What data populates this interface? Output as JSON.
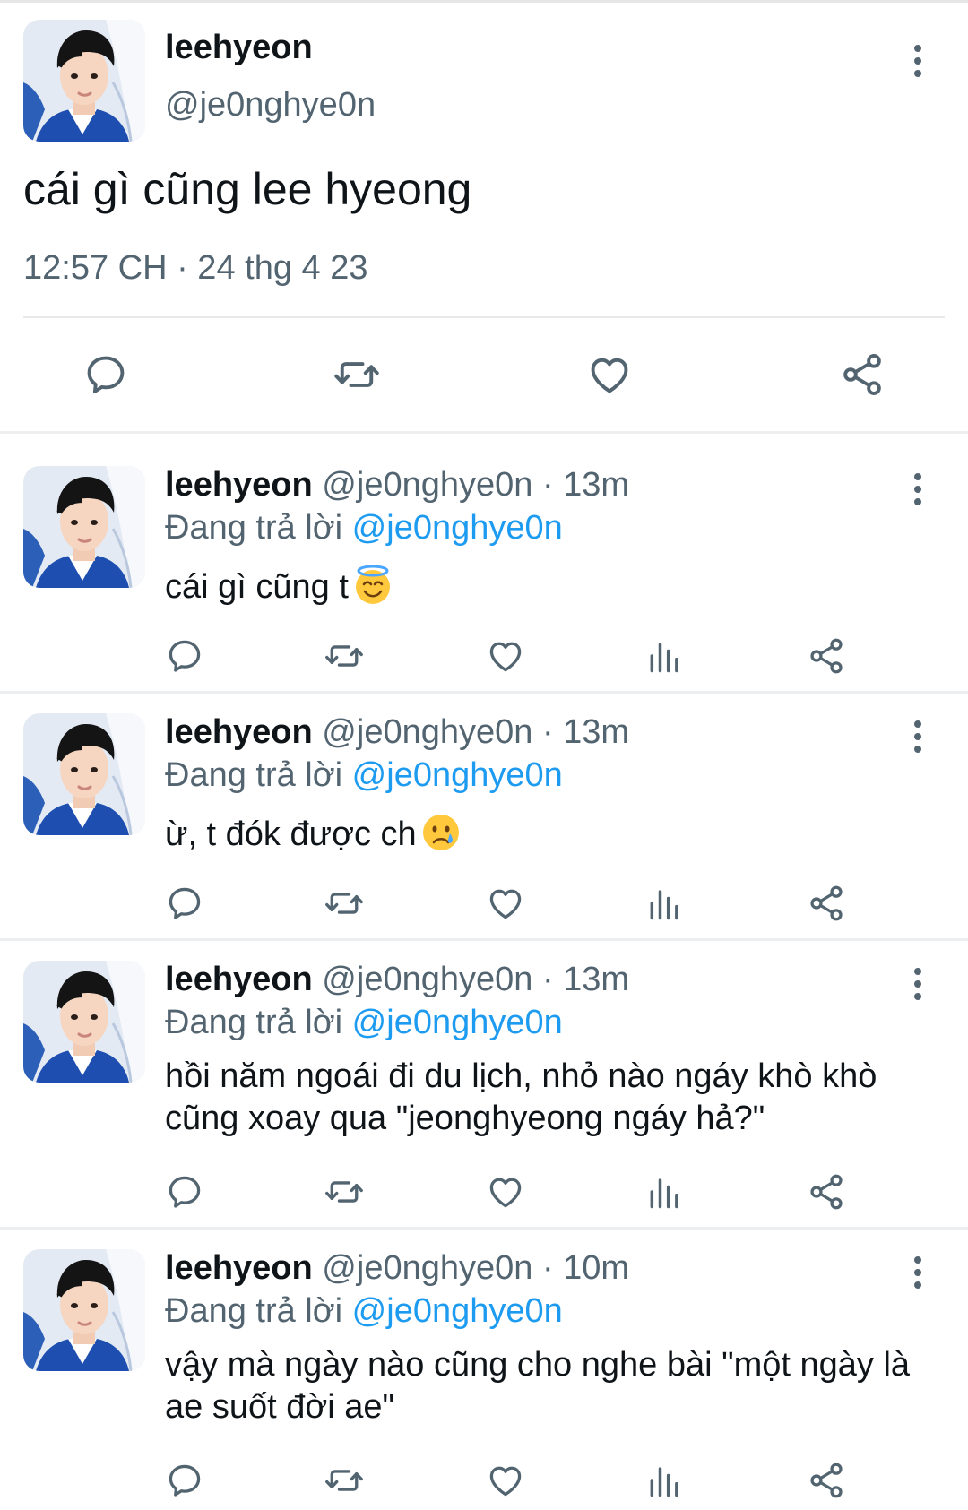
{
  "main_tweet": {
    "name": "leehyeon",
    "handle": "@je0nghye0n",
    "text": "cái gì cũng lee hyeong",
    "timestamp": "12:57 CH · 24 thg 4 23",
    "actions": [
      "reply-icon",
      "retweet-icon",
      "like-icon",
      "share-icon"
    ]
  },
  "replying_prefix": "Đang trả lời",
  "replies": [
    {
      "name": "leehyeon",
      "meta": "@je0nghye0n · 13m",
      "mention": "@je0nghye0n",
      "text": "cái gì cũng t",
      "emoji": "smiling-face-with-halo"
    },
    {
      "name": "leehyeon",
      "meta": "@je0nghye0n · 13m",
      "mention": "@je0nghye0n",
      "text": "ừ, t đók được ch",
      "emoji": "crying-face"
    },
    {
      "name": "leehyeon",
      "meta": "@je0nghye0n · 13m",
      "mention": "@je0nghye0n",
      "text": "hồi năm ngoái đi du lịch, nhỏ nào ngáy khò khò cũng xoay qua \"jeonghyeong ngáy hả?\"",
      "emoji": ""
    },
    {
      "name": "leehyeon",
      "meta": "@je0nghye0n · 10m",
      "mention": "@je0nghye0n",
      "text": "vậy mà ngày nào cũng cho nghe bài \"một ngày là ae suốt đời ae\"",
      "emoji": ""
    }
  ],
  "colors": {
    "text": "#0f1419",
    "secondary": "#536471",
    "mention": "#1d9bf0",
    "divider": "#eceef0"
  }
}
